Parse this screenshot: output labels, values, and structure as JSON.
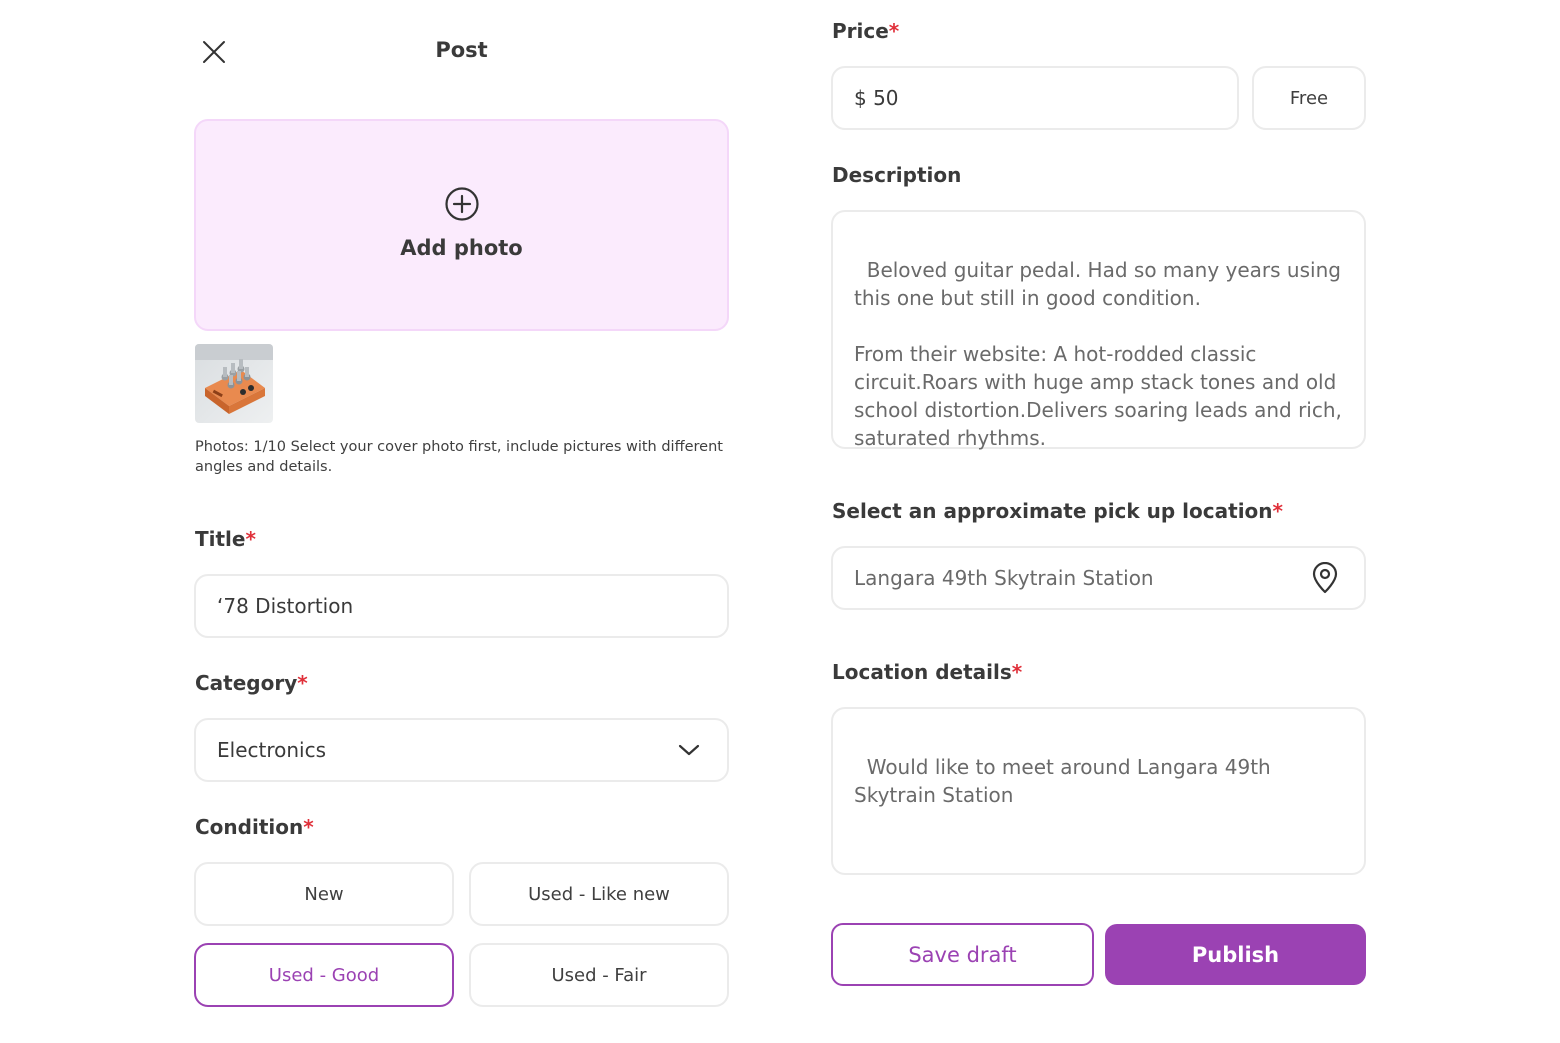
{
  "header": {
    "title": "Post",
    "close_icon": "close-icon"
  },
  "photo_upload": {
    "add_label": "Add photo",
    "icon": "plus-circle-icon",
    "note": "Photos: 1/10 Select your cover photo first, include pictures with different angles and details.",
    "thumbnail": "guitar-pedal-photo"
  },
  "title_field": {
    "label": "Title",
    "required": "*",
    "value": "‘78 Distortion"
  },
  "category_field": {
    "label": "Category",
    "required": "*",
    "value": "Electronics",
    "icon": "chevron-down-icon"
  },
  "condition_field": {
    "label": "Condition",
    "required": "*",
    "options": [
      "New",
      "Used - Like new",
      "Used - Good",
      "Used - Fair"
    ],
    "selected": "Used - Good"
  },
  "price_field": {
    "label": "Price",
    "required": "*",
    "value": "$ 50",
    "free_label": "Free"
  },
  "description_field": {
    "label": "Description",
    "value": "Beloved guitar pedal. Had so many years using this one but still in good condition.\n\nFrom their website: A hot-rodded classic circuit.Roars with huge amp stack tones and old school distortion.Delivers soaring leads and rich, saturated rhythms."
  },
  "location_field": {
    "label": "Select an approximate pick up location",
    "required": "*",
    "value": "Langara 49th Skytrain Station",
    "icon": "map-pin-icon"
  },
  "location_details_field": {
    "label": "Location details",
    "required": "*",
    "value": "Would like to meet around Langara 49th Skytrain Station"
  },
  "actions": {
    "save_draft": "Save draft",
    "publish": "Publish"
  },
  "colors": {
    "accent": "#9b42b3",
    "required": "#e0303a",
    "drop_bg": "#fbebfd",
    "border": "#ebebeb"
  }
}
